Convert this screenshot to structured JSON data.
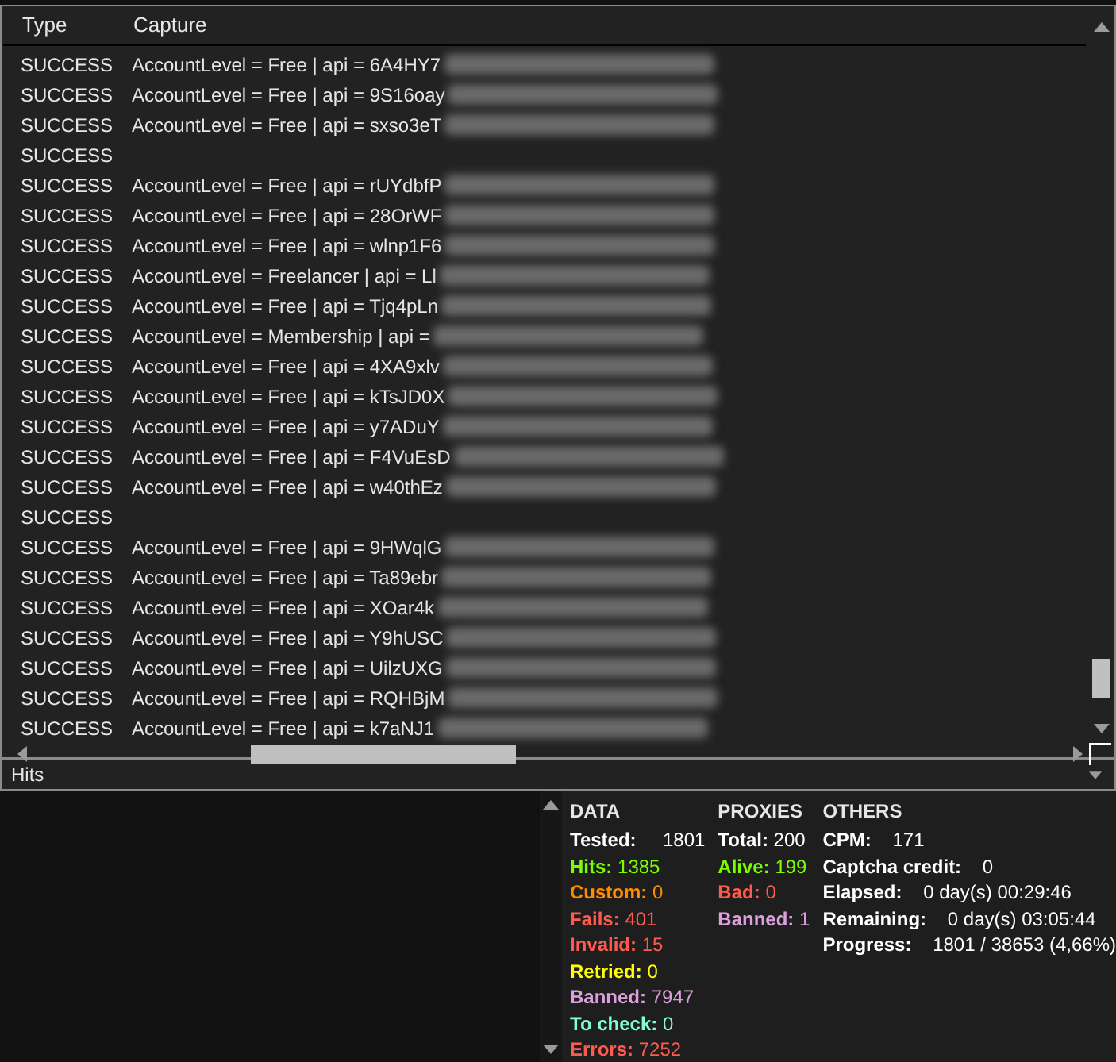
{
  "table": {
    "columns": [
      "Type",
      "Capture"
    ],
    "rows": [
      {
        "type": "SUCCESS",
        "capture": "AccountLevel = Free | api = 6A4HY7"
      },
      {
        "type": "SUCCESS",
        "capture": "AccountLevel = Free | api = 9S16oay"
      },
      {
        "type": "SUCCESS",
        "capture": "AccountLevel = Free | api = sxso3eT"
      },
      {
        "type": "SUCCESS"
      },
      {
        "type": "SUCCESS",
        "capture": "AccountLevel = Free | api = rUYdbfP"
      },
      {
        "type": "SUCCESS",
        "capture": "AccountLevel = Free | api = 28OrWF"
      },
      {
        "type": "SUCCESS",
        "capture": "AccountLevel = Free | api = wlnp1F6"
      },
      {
        "type": "SUCCESS",
        "capture": "AccountLevel = Freelancer | api = Ll"
      },
      {
        "type": "SUCCESS",
        "capture": "AccountLevel = Free | api = Tjq4pLn"
      },
      {
        "type": "SUCCESS",
        "capture": "AccountLevel = Membership | api ="
      },
      {
        "type": "SUCCESS",
        "capture": "AccountLevel = Free | api = 4XA9xlv"
      },
      {
        "type": "SUCCESS",
        "capture": "AccountLevel = Free | api = kTsJD0X"
      },
      {
        "type": "SUCCESS",
        "capture": "AccountLevel = Free | api = y7ADuY"
      },
      {
        "type": "SUCCESS",
        "capture": "AccountLevel = Free | api = F4VuEsD"
      },
      {
        "type": "SUCCESS",
        "capture": "AccountLevel = Free | api = w40thEz"
      },
      {
        "type": "SUCCESS"
      },
      {
        "type": "SUCCESS",
        "capture": "AccountLevel = Free | api = 9HWqlG"
      },
      {
        "type": "SUCCESS",
        "capture": "AccountLevel = Free | api = Ta89ebr"
      },
      {
        "type": "SUCCESS",
        "capture": "AccountLevel = Free | api = XOar4k"
      },
      {
        "type": "SUCCESS",
        "capture": "AccountLevel = Free | api = Y9hUSC"
      },
      {
        "type": "SUCCESS",
        "capture": "AccountLevel = Free | api = UilzUXG"
      },
      {
        "type": "SUCCESS",
        "capture": "AccountLevel = Free | api = RQHBjM"
      },
      {
        "type": "SUCCESS",
        "capture": "AccountLevel = Free | api = k7aNJ1"
      }
    ]
  },
  "filter": {
    "value": "Hits"
  },
  "stats": [
    {
      "title": "DATA",
      "items": [
        {
          "label": "Tested:",
          "value": "1801",
          "color": "#ffffff"
        },
        {
          "label": "Hits:",
          "value": "1385",
          "color": "#7cfc00"
        },
        {
          "label": "Custom:",
          "value": "0",
          "color": "#ff8c00"
        },
        {
          "label": "Fails:",
          "value": "401",
          "color": "#ff5a4f"
        },
        {
          "label": "Invalid:",
          "value": "15",
          "color": "#ff5a4f"
        },
        {
          "label": "Retried:",
          "value": "0",
          "color": "#ffff00"
        },
        {
          "label": "Banned:",
          "value": "7947",
          "color": "#dda0dd"
        },
        {
          "label": "To check:",
          "value": "0",
          "color": "#7fffd4"
        },
        {
          "label": "Errors:",
          "value": "7252",
          "color": "#ff5a4f"
        }
      ]
    },
    {
      "title": "PROXIES",
      "items": [
        {
          "label": "Total:",
          "value": "200",
          "color": "#ffffff"
        },
        {
          "label": "Alive:",
          "value": "199",
          "color": "#7cfc00"
        },
        {
          "label": "Bad:",
          "value": "0",
          "color": "#ff5a4f"
        },
        {
          "label": "Banned:",
          "value": "1",
          "color": "#dda0dd"
        }
      ]
    },
    {
      "title": "OTHERS",
      "items": [
        {
          "label": "CPM:",
          "value": "171",
          "color": "#ffffff"
        },
        {
          "label": "Captcha credit:",
          "value": "0",
          "color": "#ffffff"
        },
        {
          "label": "Elapsed:",
          "value": "0 day(s) 00:29:46",
          "color": "#ffffff"
        },
        {
          "label": "Remaining:",
          "value": "0 day(s) 03:05:44",
          "color": "#ffffff"
        },
        {
          "label": "Progress:",
          "value": "1801 / 38653 (4,66%)",
          "color": "#ffffff"
        }
      ]
    }
  ]
}
